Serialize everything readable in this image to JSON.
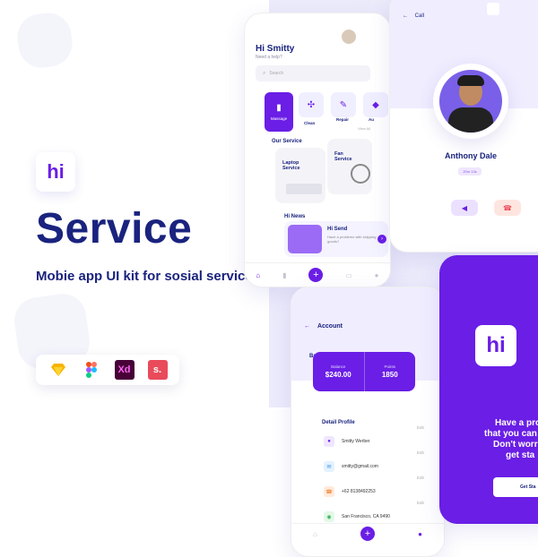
{
  "brand": {
    "logo_text": "hi",
    "title": "Service",
    "subtitle": "Mobie app UI kit for sosial service",
    "accent": "#6a1ee6",
    "navy": "#1a237e"
  },
  "tools": [
    {
      "name": "sketch-icon",
      "label": "",
      "color": "#f7b500"
    },
    {
      "name": "figma-icon",
      "label": "",
      "color": "#f24e1e"
    },
    {
      "name": "xd-icon",
      "label": "Xd",
      "color": "#470137"
    },
    {
      "name": "s-icon",
      "label": "s.",
      "color": "#e94b5b"
    }
  ],
  "home_screen": {
    "greeting": "Hi Smitty",
    "subgreeting": "Need a help?",
    "search_placeholder": "Search",
    "categories": [
      {
        "label": "Massage",
        "icon": "▮"
      },
      {
        "label": "Clean",
        "icon": "✣"
      },
      {
        "label": "Repair",
        "icon": "✎"
      },
      {
        "label": "Au",
        "icon": "◆"
      }
    ],
    "section_title": "Our Service",
    "view_all": "View All",
    "services": [
      {
        "label": "Laptop Service"
      },
      {
        "label": "Fan Service"
      }
    ],
    "news_title": "Hi News",
    "news": {
      "headline": "Hi Send",
      "body": "Have a problems with shipping goods?"
    }
  },
  "call_screen": {
    "back_label": "Call",
    "name": "Anthony Dale",
    "duration": "20m 13s"
  },
  "account_screen": {
    "title": "Account",
    "balance_label": "Balance",
    "balance_title": "Balance",
    "balance_value": "$240.00",
    "points_title": "Points",
    "points_value": "1850",
    "detail_title": "Detail Profile",
    "edit_label": "Edit",
    "rows": [
      {
        "value": "Smitty Werber",
        "icon": "👤",
        "bg": "#efe6ff"
      },
      {
        "value": "smitty@gmail.com",
        "icon": "✉",
        "bg": "#e3f2ff"
      },
      {
        "value": "+62 8138492253",
        "icon": "☎",
        "bg": "#ffeadb"
      },
      {
        "value": "San Francisco, CA 9490",
        "icon": "◉",
        "bg": "#e4f8e8"
      }
    ]
  },
  "splash_screen": {
    "logo_text": "hi",
    "headline_1": "Have a probl",
    "headline_2": "that you can s",
    "headline_3": "Don't worr",
    "headline_4": "get sta",
    "button": "Get Sta"
  }
}
